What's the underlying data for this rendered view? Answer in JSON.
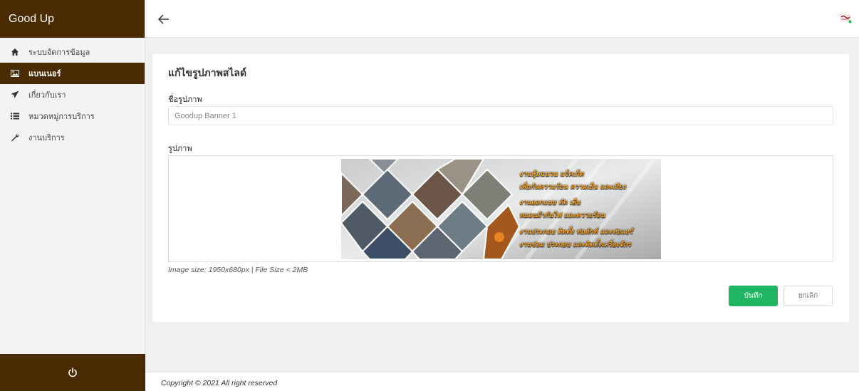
{
  "brand": {
    "title": "Good Up",
    "color": "#4a2b00"
  },
  "sidebar": {
    "items": [
      {
        "label": "ระบบจัดการข้อมูล",
        "icon": "home-icon",
        "active": false
      },
      {
        "label": "แบนเนอร์",
        "icon": "image-icon",
        "active": true
      },
      {
        "label": "เกี่ยวกับเรา",
        "icon": "paper-plane-icon",
        "active": false
      },
      {
        "label": "หมวดหมู่การบริการ",
        "icon": "list-icon",
        "active": false
      },
      {
        "label": "งานบริการ",
        "icon": "wrench-icon",
        "active": false
      }
    ],
    "power_icon": "power-icon"
  },
  "topbar": {
    "back_icon": "arrow-left-icon",
    "logo_icon": "goodup-logo-icon"
  },
  "form": {
    "title": "แก้ไขรูปภาพสไลด์",
    "name_label": "ชื่อรูปภาพ",
    "name_value": "Goodup Banner 1",
    "image_label": "รูปภาพ",
    "banner_lines": [
      "งานหุ้มฉนวน แจ็คเก็ต",
      "เพื่อกันความร้อน ความเย็น และเสียง",
      "งานออกแบบ ตัด เย็บ",
      "หมอนผ้ากันไฟ และความร้อน",
      "งานประกอบ ติดตั้ง ท่อดักท์ และท่อแอร์",
      "งานซ่อม ประกอบ และติดตั้งเครื่องจักร"
    ],
    "help_text": "Image size: 1950x680px | File Size < 2MB",
    "save_label": "บันทึก",
    "cancel_label": "ยกเลิก",
    "save_color": "#1fb563"
  },
  "footer": {
    "copyright": "Copyright © 2021 All right reserved"
  }
}
